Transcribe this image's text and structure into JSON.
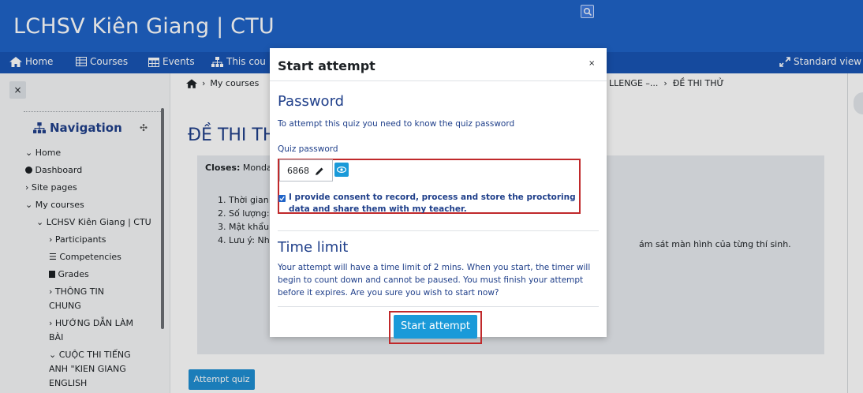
{
  "header": {
    "site_title": "LCHSV Kiên Giang | CTU"
  },
  "navbar": {
    "home": "Home",
    "courses": "Courses",
    "events": "Events",
    "this_course": "This cou",
    "standard_view": "Standard view"
  },
  "drawer": {
    "close": "×",
    "nav_title": "Navigation",
    "tree": {
      "home": "Home",
      "dashboard": "Dashboard",
      "site_pages": "Site pages",
      "my_courses": "My courses",
      "course": "LCHSV Kiên Giang | CTU",
      "participants": "Participants",
      "competencies": "Competencies",
      "grades": "Grades",
      "thong_tin_1": "THÔNG TIN",
      "thong_tin_2": "CHUNG",
      "huong_dan_1": "HƯỚNG DẪN LÀM",
      "huong_dan_2": "BÀI",
      "cuoc_thi_1": "CUỘC THI TIẾNG",
      "cuoc_thi_2": "ANH \"KIEN GIANG",
      "cuoc_thi_3": "ENGLISH"
    }
  },
  "main": {
    "crumb_left": "My courses",
    "crumb_right_a": "LLENGE –...",
    "crumb_right_b": "ĐỀ THI THỬ",
    "page_title": "ĐỀ THI TH",
    "closes_label": "Closes:",
    "closes_value": "Monday",
    "info": [
      "1. Thời gian",
      "2. Số lượng:",
      "3. Mật khẩu:",
      "4. Lưu ý: Nhà"
    ],
    "info_tail": "ám sát màn hình của từng thí sinh.",
    "attempt_button": "Attempt quiz"
  },
  "modal": {
    "title": "Start attempt",
    "close": "×",
    "password_heading": "Password",
    "password_help": "To attempt this quiz you need to know the quiz password",
    "password_label": "Quiz password",
    "password_value": "6868",
    "consent": "I provide consent to record, process and store the proctoring data and share them with my teacher.",
    "time_heading": "Time limit",
    "time_text": "Your attempt will have a time limit of 2 mins. When you start, the timer will begin to count down and cannot be paused. You must finish your attempt before it expires. Are you sure you wish to start now?",
    "start_button": "Start attempt"
  },
  "colors": {
    "header": "#1f63c8",
    "navbar": "#1855b4",
    "accent_button": "#1a9ad9",
    "highlight_border": "#c0292b",
    "heading_text": "#1f3f8a"
  }
}
